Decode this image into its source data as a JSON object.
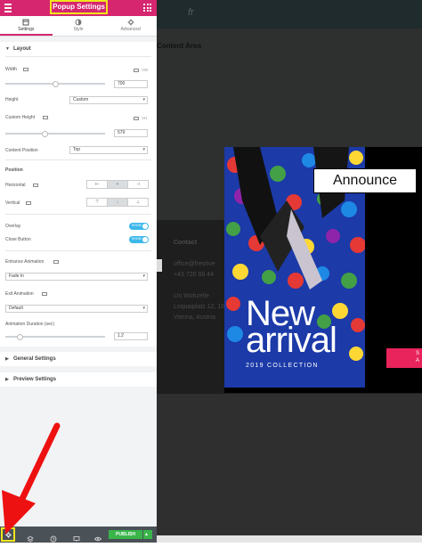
{
  "panel": {
    "title": "Popup Settings",
    "tabs": [
      {
        "label": "Settings",
        "icon": "settings-tab-icon"
      },
      {
        "label": "Style",
        "icon": "style-tab-icon"
      },
      {
        "label": "Advanced",
        "icon": "advanced-tab-icon"
      }
    ],
    "layout": {
      "heading": "Layout",
      "width_label": "Width",
      "width_unit": "VW",
      "width_value": "700",
      "width_slider_level": 0.5,
      "height_label": "Height",
      "height_value": "Custom",
      "custom_height_label": "Custom Height",
      "custom_height_unit": "VH",
      "custom_height_value": "579",
      "custom_height_slider_level": 0.4,
      "content_position_label": "Content Position",
      "content_position_value": "Top",
      "position_label": "Position",
      "horizontal_label": "Horizontal",
      "vertical_label": "Vertical",
      "overlay_label": "Overlay",
      "overlay_toggle": "SHOW",
      "close_button_label": "Close Button",
      "close_button_toggle": "SHOW",
      "entrance_animation_label": "Entrance Animation",
      "entrance_animation_value": "Fade In",
      "exit_animation_label": "Exit Animation",
      "exit_animation_value": "Default",
      "animation_duration_label": "Animation Duration (sec)",
      "animation_duration_value": "1.2",
      "animation_slider_level": 0.15
    },
    "general_settings": "General Settings",
    "preview_settings": "Preview Settings",
    "footer": {
      "publish": "PUBLISH"
    }
  },
  "preview": {
    "content_area": "Content Area",
    "footer_contact": "Contact",
    "footer_email": "office@freshve",
    "footer_phone": "+43 720 88 44",
    "footer_addr1": "c/o Wohzelle",
    "footer_addr2": "Loquaiplatz 12, 10",
    "footer_addr3": "Vienna, Austria",
    "popup": {
      "announce": "Announce",
      "headline_line1": "New",
      "headline_line2": "arrival",
      "subline": "2019 COLLECTION",
      "shop_line1": "S",
      "shop_line2": "A"
    }
  },
  "colors": {
    "brand": "#d5266f",
    "highlight": "#f0e51b",
    "toggle": "#3db8ea",
    "publish": "#39b54a",
    "cta": "#e9235c"
  }
}
